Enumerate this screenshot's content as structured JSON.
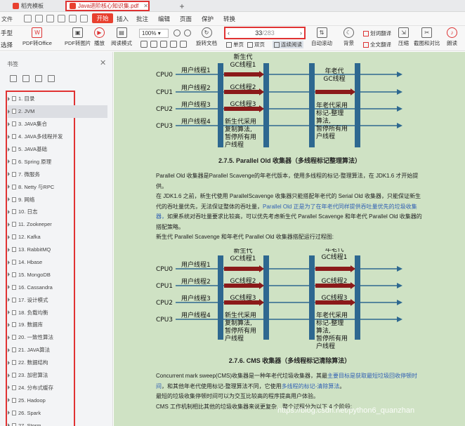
{
  "tabs": [
    {
      "label": "稻壳模板",
      "color": "#e8402f"
    },
    {
      "label": "Java进阶核心知识集.pdf",
      "color": "#e8402f"
    }
  ],
  "tab_add": "+",
  "menu": {
    "file": "文件",
    "start": "开始",
    "items": [
      "插入",
      "批注",
      "编辑",
      "页面",
      "保护",
      "转换"
    ]
  },
  "toolbar": {
    "left_stub_top": "手型",
    "left_stub_bottom": "选择",
    "pdf_to_office": "PDF转Office",
    "pdf_to_image": "PDF转图片",
    "play": "播放",
    "read_mode": "阅读模式",
    "zoom": "100%",
    "rotate": "旋转文档",
    "current_page": "33",
    "total_pages": "/283",
    "single_page": "单页",
    "double_page": "双页",
    "continuous": "连续阅读",
    "auto_scroll": "自动滚动",
    "background": "背景",
    "translate_selected": "划词翻译",
    "translate_full": "全文翻译",
    "compress": "压缩",
    "compare": "截图和对比",
    "read_aloud": "朗读"
  },
  "sidebar": {
    "title": "书签",
    "items": [
      "1. 目录",
      "2. JVM",
      "3. JAVA集合",
      "4. JAVA多线程并发",
      "5. JAVA基础",
      "6. Spring 原理",
      "7.  微服务",
      "8. Netty 与RPC",
      "9. 网络",
      "10. 日志",
      "11. Zookeeper",
      "12. Kafka",
      "13. RabbitMQ",
      "14. Hbase",
      "15. MongoDB",
      "16. Cassandra",
      "17. 设计模式",
      "18. 负载均衡",
      "19. 数据库",
      "20. 一致性算法",
      "21. JAVA算法",
      "22. 数据结构",
      "23. 加密算法",
      "24. 分布式缓存",
      "25. Hadoop",
      "26. Spark",
      "27. Storm"
    ]
  },
  "diagram1": {
    "cpus": [
      "CPU0",
      "CPU1",
      "CPU2",
      "CPU3"
    ],
    "users": [
      "用户线程1",
      "用户线程2",
      "用户线程3",
      "用户线程4"
    ],
    "gc_top": "新生代\nGC线程1",
    "gc2": "GC线程2",
    "gc3": "GC线程3",
    "young_note": "新生代采用\n复制算法,\n暂停所有用\n户线程",
    "old_top": "年老代\nGC线程",
    "old_note": "年老代采用\n标记-整理\n算法,\n暂停所有用\n户线程"
  },
  "section1_title": "2.7.5.  Parallel Old 收集器（多线程标记整理算法）",
  "section1_paragraphs": [
    "Parallel Old 收集器是Parallel Scavenge的年老代版本，使用多线程的标记-整理算法，在 JDK1.6 才开始提供。",
    "在 JDK1.6 之前，新生代使用 ParallelScavenge 收集器只能搭配年老代的 Serial Old 收集器，只能保证新生代的吞吐量优先，无法保证整体的吞吐量，",
    "Parallel Old 正是为了在年老代同样提供吞吐量优先的垃圾收集器，",
    "如果系统对吞吐量要求比较高，可以优先考虑新生代 Parallel Scavenge 和年老代 Parallel Old 收集器的搭配策略。",
    "新生代 Parallel Scavenge 和年老代 Parallel Old 收集器搭配运行过程图:"
  ],
  "diagram2": {
    "cpus": [
      "CPU0",
      "CPU1",
      "CPU2",
      "CPU3"
    ],
    "users": [
      "用户线程1",
      "用户线程2",
      "用户线程3",
      "用户线程4"
    ],
    "gc_top": "新生代\nGC线程1",
    "gc2": "GC线程2",
    "gc3": "GC线程3",
    "young_note": "新生代采用\n复制算法,\n暂停所有用\n户线程",
    "old_top": "年老代\nGC线程1",
    "old2": "GC线程2",
    "old3": "GC线程3",
    "old_note": "年老代采用\n标记-整理\n算法,\n暂停所有用\n户线程",
    "watermark": "https://blog.csdn.net/python6_quanzhan"
  },
  "section2_title": "2.7.6.  CMS 收集器（多线程标记清除算法）",
  "section2_paragraphs": [
    "Concurrent mark sweep(CMS)收集器是一种年老代垃圾收集器，其最",
    "主要目标是获取最短垃圾回收停顿时间",
    "，和其他年老代使用标记-整理算法不同，它使用",
    "多线程的标记-清除算法",
    "。",
    "最短的垃圾收集停顿时间可以为交互比较高的程序提高用户体验。",
    "CMS 工作机制相比其他的垃圾收集器来说更复杂，整个过程分为以下 4 个阶段:"
  ],
  "colors": {
    "accent": "#e8402f",
    "highlight_border": "#e03232",
    "doc_bg": "#cfe2c4",
    "bar_blue": "#2e6890",
    "arrow_red": "#8b1a1a",
    "link_blue": "#2f5fb3"
  }
}
